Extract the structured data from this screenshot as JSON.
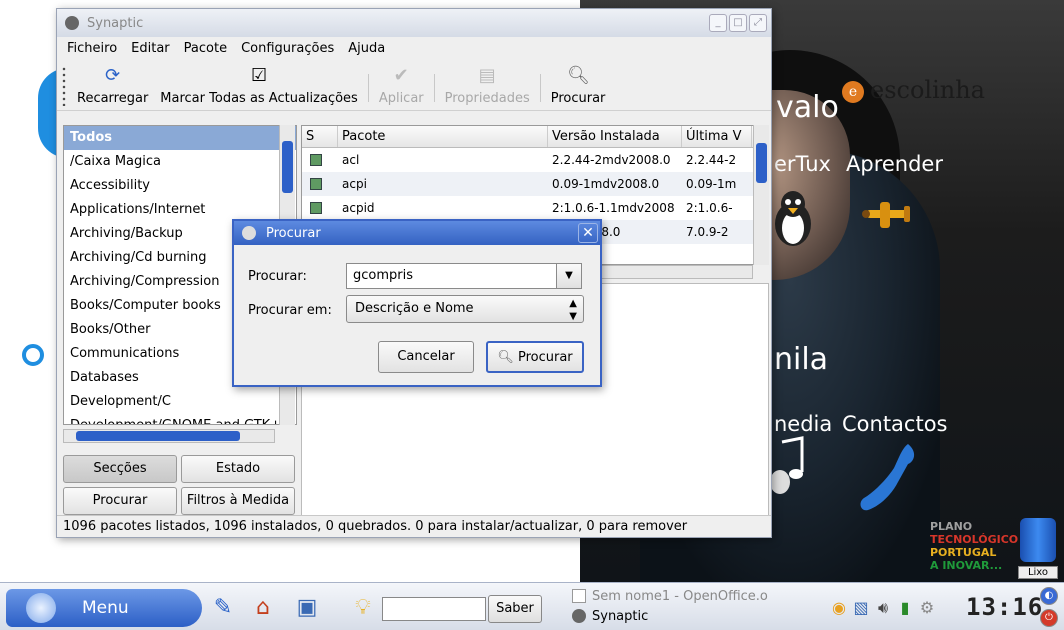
{
  "desktop": {
    "labels": [
      "valo",
      "erTux",
      "Aprender",
      "nila",
      "nedia",
      "Contactos"
    ],
    "brand": "escolinha",
    "plano_lines": [
      "PLANO",
      "TECNOLÓGICO",
      "PORTUGAL",
      "A INOVAR..."
    ],
    "trash_label": "Lixo"
  },
  "synaptic": {
    "title": "Synaptic",
    "menu": [
      "Ficheiro",
      "Editar",
      "Pacote",
      "Configurações",
      "Ajuda"
    ],
    "toolbar": {
      "reload": "Recarregar",
      "mark_all": "Marcar Todas as Actualizações",
      "apply": "Aplicar",
      "properties": "Propriedades",
      "search": "Procurar"
    },
    "sections": [
      "Todos",
      "/Caixa Magica",
      "Accessibility",
      "Applications/Internet",
      "Archiving/Backup",
      "Archiving/Cd burning",
      "Archiving/Compression",
      "Books/Computer books",
      "Books/Other",
      "Communications",
      "Databases",
      "Development/C",
      "Development/GNOME and GTK+"
    ],
    "left_buttons": {
      "sections": "Secções",
      "status": "Estado",
      "search": "Procurar",
      "custom_filters": "Filtros à Medida"
    },
    "table": {
      "headers": [
        "S",
        "Pacote",
        "Versão Instalada",
        "Última V"
      ],
      "rows": [
        {
          "name": "acl",
          "installed": "2.2.44-2mdv2008.0",
          "latest": "2.2.44-2"
        },
        {
          "name": "acpi",
          "installed": "0.09-1mdv2008.0",
          "latest": "0.09-1m"
        },
        {
          "name": "acpid",
          "installed": "2:1.0.6-1.1mdv2008",
          "latest": "2:1.0.6-"
        },
        {
          "name": "",
          "installed": "mdv2008.0",
          "latest": "7.0.9-2"
        }
      ]
    },
    "statusbar": "1096 pacotes listados, 1096 instalados, 0 quebrados. 0 para instalar/actualizar, 0 para remover"
  },
  "dialog": {
    "title": "Procurar",
    "search_label": "Procurar:",
    "search_value": "gcompris",
    "search_in_label": "Procurar em:",
    "search_in_value": "Descrição e Nome",
    "cancel": "Cancelar",
    "submit": "Procurar"
  },
  "taskbar": {
    "menu_label": "Menu",
    "saber_button": "Saber",
    "tasks": [
      "Sem nome1 - OpenOffice.o",
      "Synaptic"
    ],
    "clock": "13:16"
  }
}
